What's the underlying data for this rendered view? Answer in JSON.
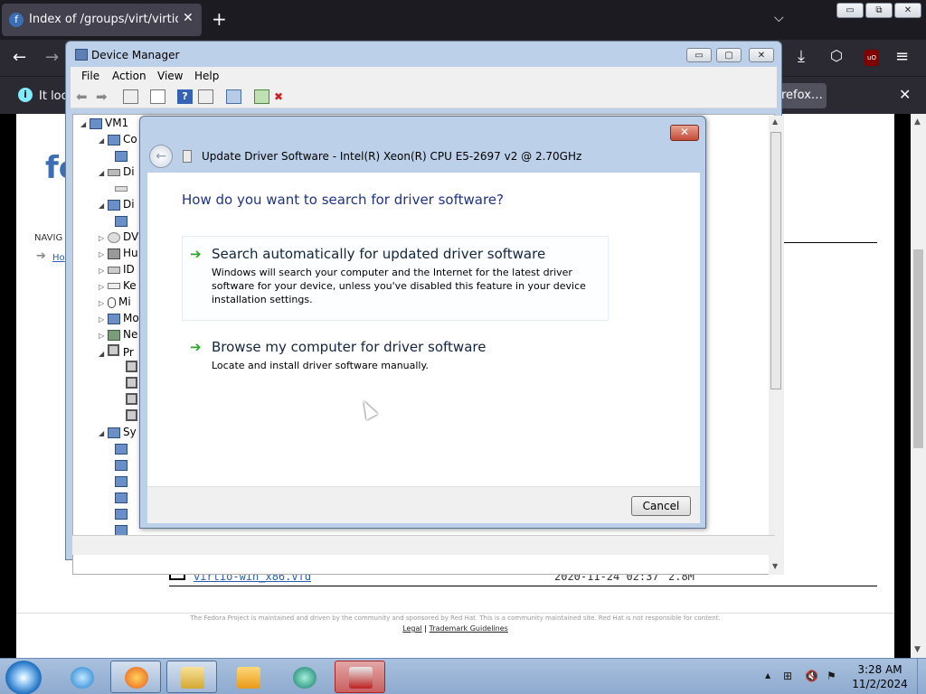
{
  "browser": {
    "tab_title": "Index of /groups/virt/virtio-win",
    "tab_favicon_glyph": "f",
    "notice_text": "It loo",
    "notice_button": "refox…",
    "window_controls": {
      "minimize": "▭",
      "restore": "⧉",
      "close": "✕"
    },
    "nav_icons": [
      "arrow-left-icon",
      "arrow-right-icon",
      "download-icon",
      "extensions-icon",
      "ublock-icon",
      "menu-icon"
    ]
  },
  "page": {
    "partial_logo": "fe",
    "nav_label": "NAVIG",
    "nav_link": "Ho",
    "file_row": {
      "name": "virtio-win_x86.vfd",
      "date": "2020-11-24 02:37",
      "size": "2.8M"
    },
    "footer_text": "The Fedora Project is maintained and driven by the community and sponsored by Red Hat. This is a community maintained site. Red Hat is not responsible for content.",
    "footer_links": [
      "Legal",
      "Trademark Guidelines"
    ],
    "footer_sep": "|"
  },
  "device_manager": {
    "title": "Device Manager",
    "menu": [
      "File",
      "Action",
      "View",
      "Help"
    ],
    "tree": [
      {
        "label": "VM1",
        "expander": "◢"
      },
      {
        "label": "Co",
        "expander": "◢"
      },
      {
        "label": "Di",
        "expander": "◢"
      },
      {
        "label": "Di",
        "expander": "◢"
      },
      {
        "label": "DV",
        "expander": "▷"
      },
      {
        "label": "Hu",
        "expander": "▷"
      },
      {
        "label": "ID",
        "expander": "▷"
      },
      {
        "label": "Ke",
        "expander": "▷"
      },
      {
        "label": "Mi",
        "expander": "▷"
      },
      {
        "label": "Mo",
        "expander": "▷"
      },
      {
        "label": "Ne",
        "expander": "▷"
      },
      {
        "label": "Pr",
        "expander": "◢"
      },
      {
        "label": "Sy",
        "expander": "◢"
      }
    ]
  },
  "update_dialog": {
    "title": "Update Driver Software - Intel(R) Xeon(R) CPU E5-2697 v2 @ 2.70GHz",
    "heading": "How do you want to search for driver software?",
    "back_glyph": "←",
    "close_glyph": "✕",
    "options": [
      {
        "title": "Search automatically for updated driver software",
        "desc": "Windows will search your computer and the Internet for the latest driver software for your device, unless you've disabled this feature in your device installation settings."
      },
      {
        "title": "Browse my computer for driver software",
        "desc": "Locate and install driver software manually."
      }
    ],
    "arrow_glyph": "➔",
    "cancel": "Cancel"
  },
  "taskbar": {
    "time": "3:28 AM",
    "date": "11/2/2024",
    "tray_chevron": "▲",
    "apps": [
      "internet-explorer-icon",
      "firefox-icon",
      "file-explorer-icon",
      "media-player-icon",
      "app-icon",
      "toolbox-icon"
    ]
  }
}
